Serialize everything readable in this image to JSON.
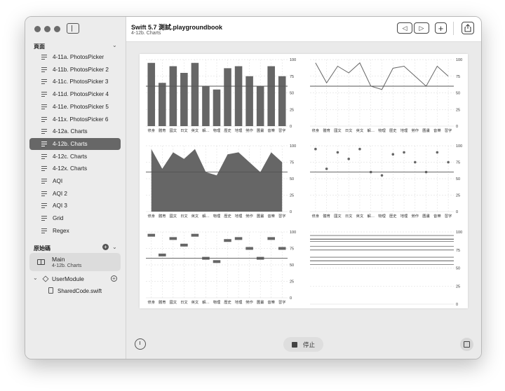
{
  "window": {
    "title": "Swift 5.7 測試.playgroundbook",
    "subtitle": "4-12b. Charts"
  },
  "sidebar": {
    "pages_section": "頁面",
    "source_section": "原始碼",
    "pages": [
      {
        "label": "4-11a. PhotosPicker",
        "selected": false
      },
      {
        "label": "4-11b. PhotosPicker 2",
        "selected": false
      },
      {
        "label": "4-11c. PhotosPicker 3",
        "selected": false
      },
      {
        "label": "4-11d. PhotosPicker 4",
        "selected": false
      },
      {
        "label": "4-11e. PhotosPicker 5",
        "selected": false
      },
      {
        "label": "4-11x. PhotosPicker 6",
        "selected": false
      },
      {
        "label": "4-12a. Charts",
        "selected": false
      },
      {
        "label": "4-12b. Charts",
        "selected": true
      },
      {
        "label": "4-12c. Charts",
        "selected": false
      },
      {
        "label": "4-12x. Charts",
        "selected": false
      },
      {
        "label": "AQI",
        "selected": false
      },
      {
        "label": "AQI 2",
        "selected": false
      },
      {
        "label": "AQI 3",
        "selected": false
      },
      {
        "label": "Grid",
        "selected": false
      },
      {
        "label": "Regex",
        "selected": false
      }
    ],
    "main_item": {
      "title": "Main",
      "subtitle": "4-12b. Charts"
    },
    "user_module": "UserModule",
    "shared_code": "SharedCode.swift"
  },
  "toolbar": {
    "back_icon": "triangle-left-icon",
    "forward_icon": "triangle-right-icon",
    "add_icon": "plus-icon",
    "share_icon": "share-icon"
  },
  "bottom": {
    "stop_label": "停止"
  },
  "chart_data": [
    {
      "type": "bar",
      "categories": [
        "修身",
        "體育",
        "國文",
        "日文",
        "英文",
        "解...",
        "物理",
        "歷史",
        "地理",
        "勞作",
        "圖畫",
        "音樂",
        "習字"
      ],
      "values": [
        95,
        65,
        90,
        80,
        95,
        60,
        55,
        87,
        90,
        75,
        60,
        90,
        75
      ],
      "rule": 60,
      "ylim": [
        0,
        100
      ],
      "yticks": [
        0,
        25,
        50,
        75,
        100
      ]
    },
    {
      "type": "line",
      "categories": [
        "修身",
        "體育",
        "國文",
        "日文",
        "英文",
        "解...",
        "物理",
        "歷史",
        "地理",
        "勞作",
        "圖畫",
        "音樂",
        "習字"
      ],
      "values": [
        95,
        65,
        90,
        80,
        95,
        60,
        55,
        87,
        90,
        75,
        60,
        90,
        75
      ],
      "rule": 60,
      "ylim": [
        0,
        100
      ],
      "yticks": [
        0,
        25,
        50,
        75,
        100
      ]
    },
    {
      "type": "area",
      "categories": [
        "修身",
        "體育",
        "國文",
        "日文",
        "英文",
        "解...",
        "物理",
        "歷史",
        "地理",
        "勞作",
        "圖畫",
        "音樂",
        "習字"
      ],
      "values": [
        95,
        65,
        90,
        80,
        95,
        60,
        55,
        87,
        90,
        75,
        60,
        90,
        75
      ],
      "rule": 60,
      "ylim": [
        0,
        100
      ],
      "yticks": [
        0,
        25,
        50,
        75,
        100
      ]
    },
    {
      "type": "scatter",
      "categories": [
        "修身",
        "體育",
        "國文",
        "日文",
        "英文",
        "解...",
        "物理",
        "歷史",
        "地理",
        "勞作",
        "圖畫",
        "音樂",
        "習字"
      ],
      "values": [
        95,
        65,
        90,
        80,
        95,
        60,
        55,
        87,
        90,
        75,
        60,
        90,
        75
      ],
      "rule": 60,
      "ylim": [
        0,
        100
      ],
      "yticks": [
        0,
        25,
        50,
        75,
        100
      ]
    },
    {
      "type": "rectangle",
      "categories": [
        "修身",
        "體育",
        "國文",
        "日文",
        "英文",
        "解...",
        "物理",
        "歷史",
        "地理",
        "勞作",
        "圖畫",
        "音樂",
        "習字"
      ],
      "values": [
        95,
        65,
        90,
        80,
        95,
        60,
        55,
        87,
        90,
        75,
        60,
        90,
        75
      ],
      "rule": 60,
      "ylim": [
        0,
        100
      ],
      "yticks": [
        0,
        25,
        50,
        75,
        100
      ]
    },
    {
      "type": "rule",
      "categories": [],
      "values": [
        95,
        65,
        90,
        80,
        95,
        60,
        55,
        87,
        90,
        75,
        60,
        90,
        75
      ],
      "rule": 60,
      "ylim": [
        0,
        100
      ],
      "yticks": [
        0,
        25,
        50,
        75,
        100
      ]
    }
  ]
}
